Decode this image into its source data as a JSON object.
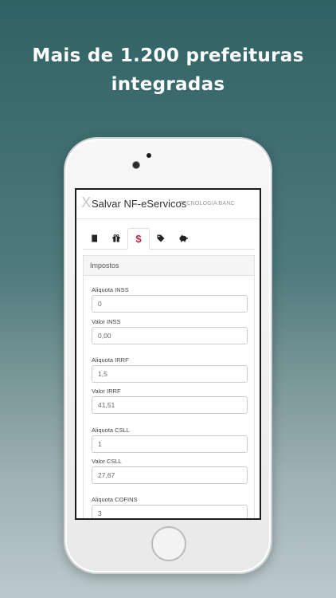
{
  "headline": {
    "line1": "Mais de 1.200 prefeituras",
    "line2": "integradas"
  },
  "app": {
    "close_glyph": "X",
    "title": "Salvar NF-eServicos",
    "subtitle": "TECNOLOGIA BANC"
  },
  "tabs": [
    {
      "icon": "book-icon",
      "active": false
    },
    {
      "icon": "gift-icon",
      "active": false
    },
    {
      "icon": "dollar-icon",
      "label": "$",
      "active": true
    },
    {
      "icon": "tag-icon",
      "active": false
    },
    {
      "icon": "piggy-bank-icon",
      "active": false
    }
  ],
  "panel": {
    "title": "Impostos",
    "fields": [
      {
        "label": "Aliquota INSS",
        "value": "0"
      },
      {
        "label": "Valor INSS",
        "value": "0,00"
      },
      {
        "label": "Aliquota IRRF",
        "value": "1,5"
      },
      {
        "label": "Valor IRRF",
        "value": "41,51"
      },
      {
        "label": "Aliquota CSLL",
        "value": "1"
      },
      {
        "label": "Valor CSLL",
        "value": "27,67"
      },
      {
        "label": "Aliquota COFINS",
        "value": "3"
      }
    ]
  },
  "colors": {
    "accent": "#b5294a",
    "background_top": "#2f6264",
    "background_bottom": "#bcc9cb"
  }
}
